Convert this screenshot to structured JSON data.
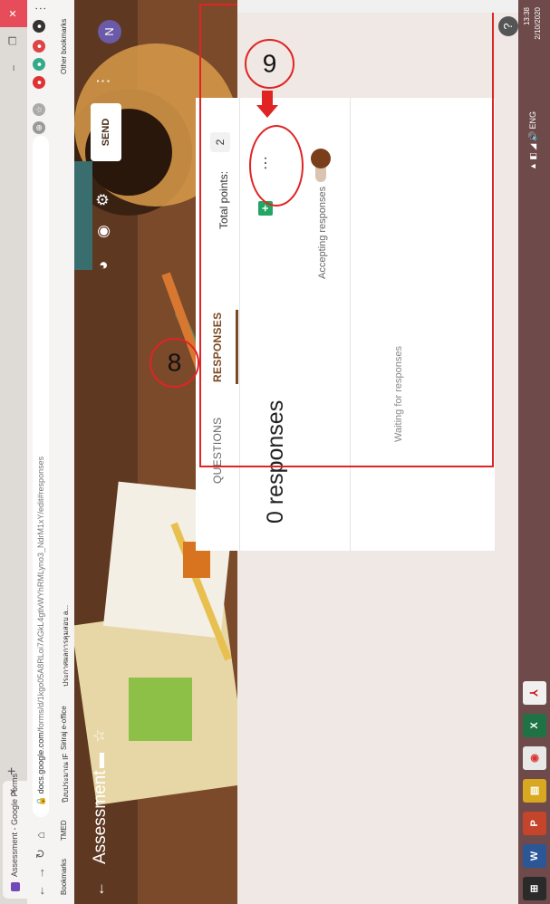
{
  "browser": {
    "tab_title": "Assessment - Google Forms",
    "url_host": "docs.google.com",
    "url_path": "/forms/d/1kgo05A8RLoi7AGkL4gtlvWYhRMLyno3_NdrM1xY/edit#responses",
    "bookmarks": [
      "Bookmarks",
      "TMED",
      "ปีงบประมาณ IF",
      "Siriraj e-office",
      "ประกาศผลการคุมสอบ a..."
    ],
    "other_bookmarks": "Other bookmarks"
  },
  "header": {
    "title": "Assessment",
    "send_label": "SEND",
    "avatar_letter": "N"
  },
  "tabs": {
    "questions": "QUESTIONS",
    "responses": "RESPONSES"
  },
  "points": {
    "label": "Total points:",
    "value": "2"
  },
  "responses": {
    "count_text": "0 responses",
    "accepting_label": "Accepting responses",
    "waiting_text": "Waiting for responses"
  },
  "annotations": {
    "marker_8": "8",
    "marker_9": "9"
  },
  "taskbar": {
    "tray_text": "ENG",
    "time": "13:38",
    "date": "2/10/2020"
  },
  "colors": {
    "accent": "#7a4a24",
    "annotation": "#e02424",
    "sheets": "#22a565"
  }
}
